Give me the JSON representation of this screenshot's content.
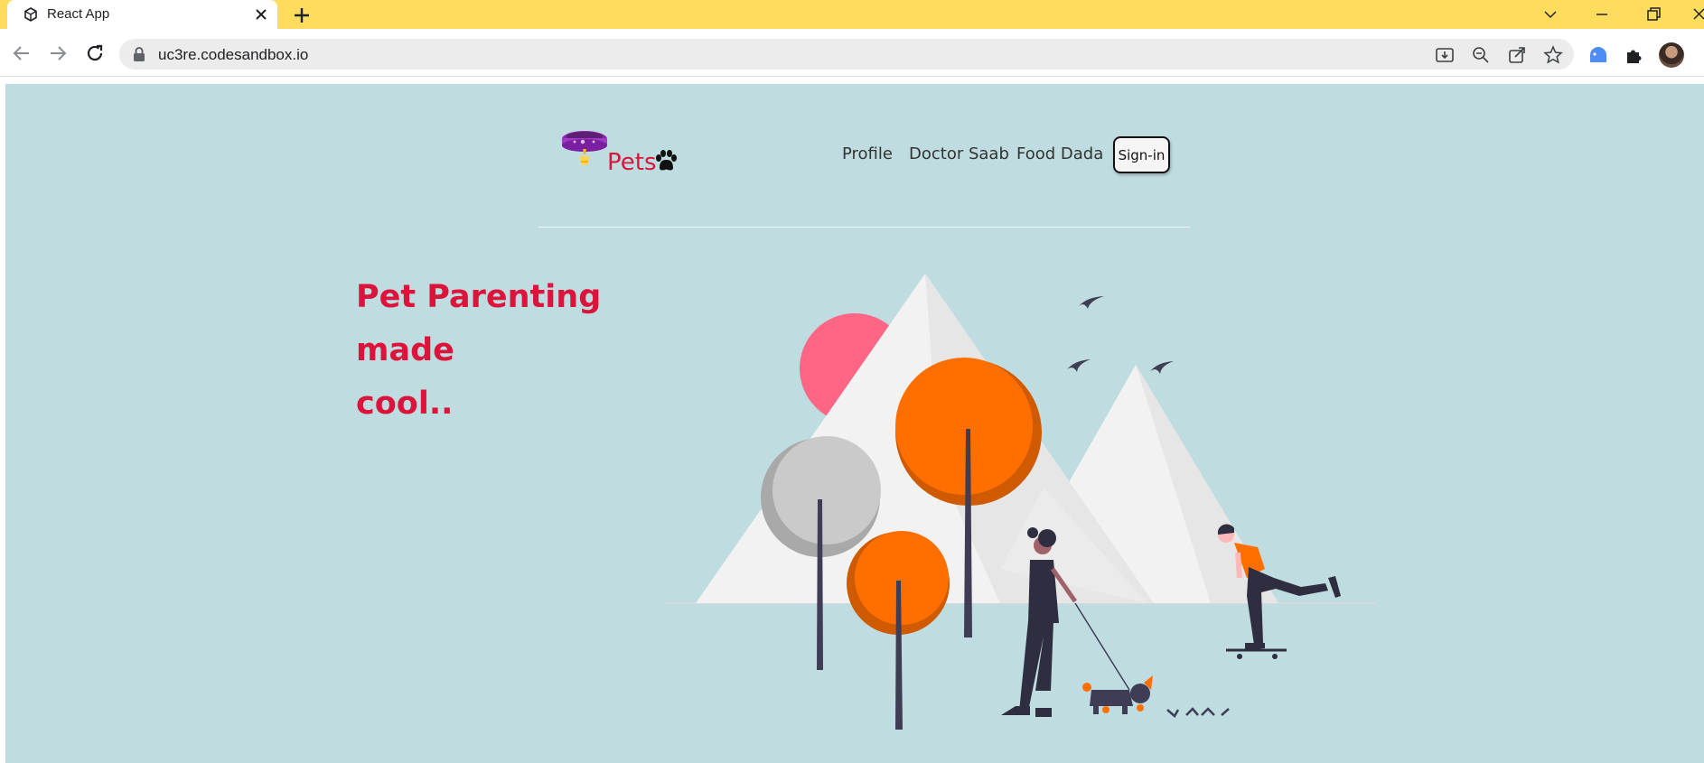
{
  "browser": {
    "tab_title": "React App",
    "url": "uc3re.codesandbox.io"
  },
  "page": {
    "logo_text": "Pets",
    "nav_items": [
      "Profile",
      "Doctor Saab",
      "Food Dada"
    ],
    "signin_label": "Sign-in",
    "hero_line1": "Pet Parenting made",
    "hero_line2": "cool.."
  },
  "colors": {
    "tab_strip": "#fedd5e",
    "page_bg": "#bfdde0",
    "accent": "#dc143c",
    "tree_orange": "#ff6f00",
    "sun_pink": "#ff6584"
  }
}
